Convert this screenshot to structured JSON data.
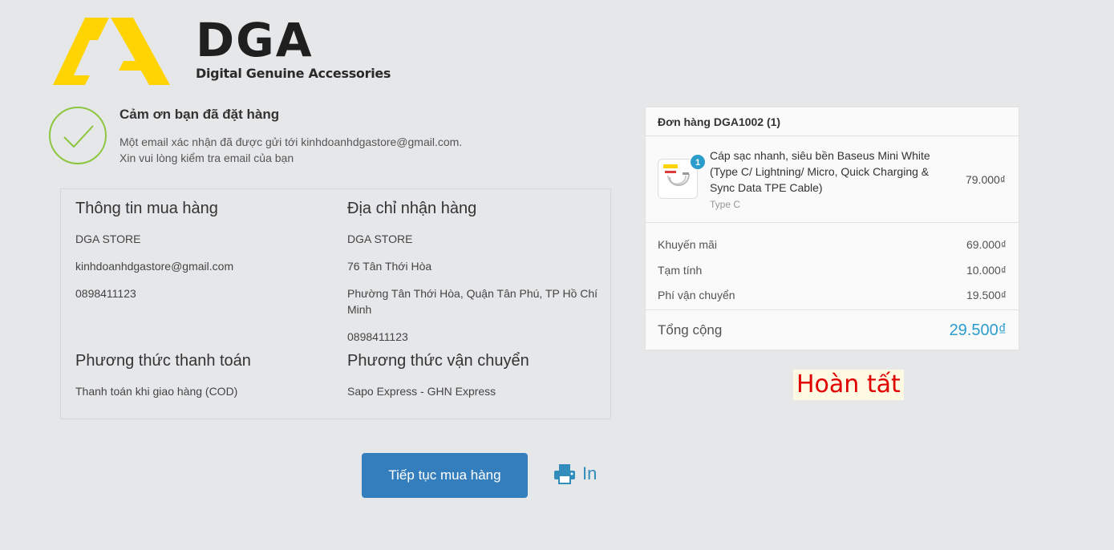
{
  "brand": {
    "name": "DGA",
    "tagline": "Digital Genuine Accessories",
    "accent": "#ffd400"
  },
  "thanks": {
    "title": "Cảm ơn bạn đã đặt hàng",
    "line1": "Một email xác nhận đã được gửi tới kinhdoanhdgastore@gmail.com.",
    "line2": "Xin vui lòng kiểm tra email của bạn",
    "icon": "check-icon",
    "color": "#8cc63f"
  },
  "purchase_info": {
    "title": "Thông tin mua hàng",
    "name": "DGA STORE",
    "email": "kinhdoanhdgastore@gmail.com",
    "phone": "0898411123"
  },
  "shipping_address": {
    "title": "Địa chỉ nhận hàng",
    "name": "DGA STORE",
    "street": "76 Tân Thới Hòa",
    "area": "Phường Tân Thới Hòa, Quận Tân Phú, TP Hồ Chí Minh",
    "phone": "0898411123"
  },
  "payment": {
    "title": "Phương thức thanh toán",
    "value": "Thanh toán khi giao hàng (COD)"
  },
  "delivery": {
    "title": "Phương thức vận chuyển",
    "value": "Sapo Express - GHN Express"
  },
  "actions": {
    "continue_label": "Tiếp tục mua hàng",
    "print_label": "In",
    "primary_color": "#357ebd"
  },
  "order": {
    "header": "Đơn hàng DGA1002 (1)",
    "item": {
      "name": "Cáp sạc nhanh, siêu bền Baseus Mini White (Type C/ Lightning/ Micro, Quick Charging & Sync Data TPE Cable)",
      "variant": "Type C",
      "price": "79.000₫",
      "quantity": "1"
    },
    "lines": [
      {
        "label": "Khuyến mãi",
        "value": "69.000₫"
      },
      {
        "label": "Tạm tính",
        "value": "10.000₫"
      },
      {
        "label": "Phí vận chuyển",
        "value": "19.500₫"
      }
    ],
    "total_label": "Tổng cộng",
    "total_value": "29.500₫",
    "total_color": "#2a9dcc"
  },
  "status_label": "Hoàn tất"
}
